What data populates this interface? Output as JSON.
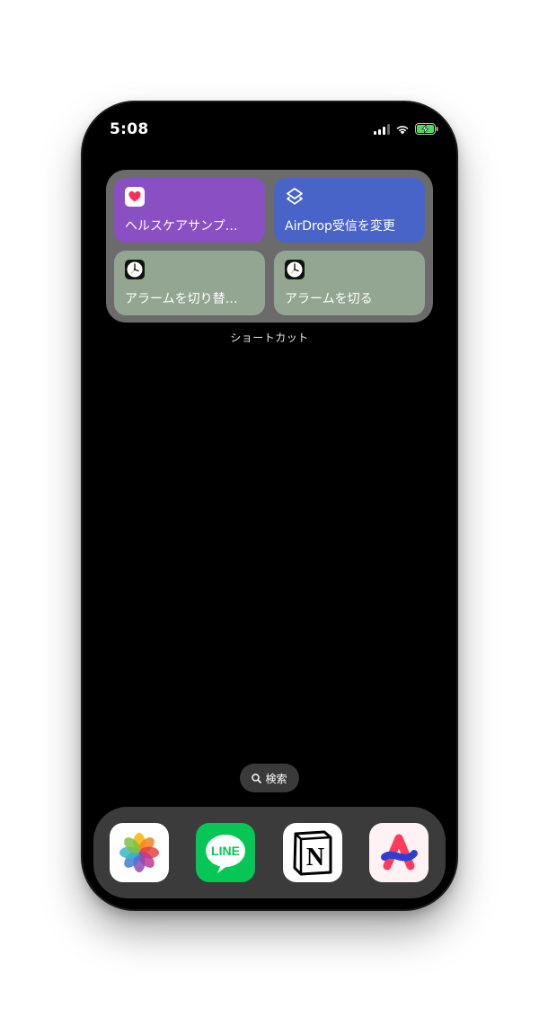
{
  "status_bar": {
    "time": "5:08",
    "battery_color": "#4cd964"
  },
  "widget": {
    "caption": "ショートカット",
    "tiles": [
      {
        "label": "ヘルスケアサンプ…",
        "icon": "health-heart-icon",
        "color": "#8b4fc4"
      },
      {
        "label": "AirDrop受信を変更",
        "icon": "shortcuts-layers-icon",
        "color": "#4864c9"
      },
      {
        "label": "アラームを切り替…",
        "icon": "clock-icon",
        "color": "#93a692"
      },
      {
        "label": "アラームを切る",
        "icon": "clock-icon",
        "color": "#93a692"
      }
    ]
  },
  "search": {
    "label": "検索",
    "icon": "search-icon"
  },
  "dock": {
    "apps": [
      {
        "name": "Photos",
        "icon": "photos-app-icon"
      },
      {
        "name": "LINE",
        "icon": "line-app-icon",
        "text": "LINE"
      },
      {
        "name": "Notion",
        "icon": "notion-app-icon",
        "text": "N"
      },
      {
        "name": "Arc",
        "icon": "arc-app-icon"
      }
    ]
  }
}
